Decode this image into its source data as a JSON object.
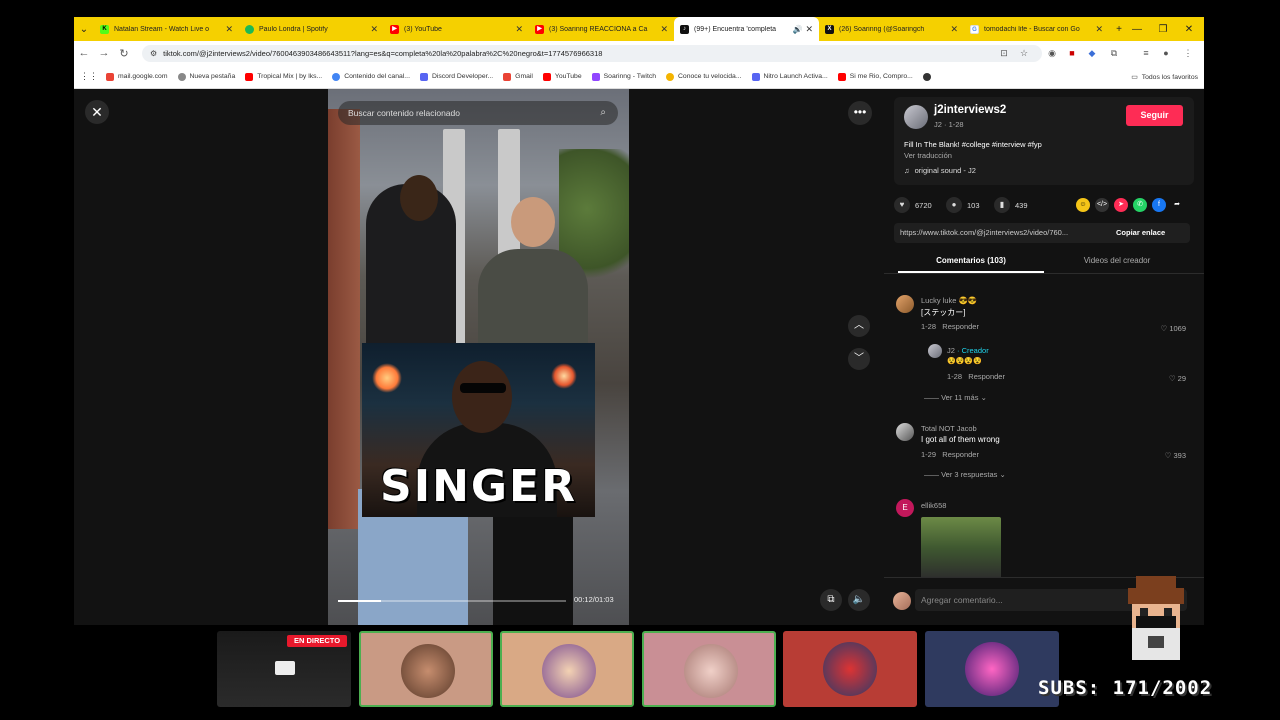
{
  "browser": {
    "tabs": [
      {
        "label": "Natalan Stream - Watch Live o",
        "favicon": "kick",
        "color": "#53fc18",
        "active": false
      },
      {
        "label": "Paulo Londra | Spotify",
        "favicon": "spotify",
        "color": "#1db954",
        "active": false
      },
      {
        "label": "(3) YouTube",
        "favicon": "youtube",
        "color": "#ff0000",
        "active": false
      },
      {
        "label": "(3) Soarinng REACCIONA a Ca",
        "favicon": "youtube",
        "color": "#ff0000",
        "active": false
      },
      {
        "label": "(99+) Encuentra 'completa",
        "favicon": "tiktok",
        "color": "#111111",
        "active": true
      },
      {
        "label": "(26) Soarinng (@Soaringch",
        "favicon": "x",
        "color": "#111111",
        "active": false
      },
      {
        "label": "tomodachi life - Buscar con Go",
        "favicon": "google",
        "color": "#4285f4",
        "active": false
      }
    ],
    "new_tab": "+",
    "url": "tiktok.com/@j2interviews2/video/7600463903486643511?lang=es&q=completa%20la%20palabra%2C%20negro&t=1774576966318",
    "bookmarks": [
      {
        "label": "mail.google.com",
        "color": "#ea4335"
      },
      {
        "label": "Nueva pestaña",
        "color": "#888888"
      },
      {
        "label": "Tropical Mix | by lks...",
        "color": "#ff0000"
      },
      {
        "label": "Contenido del canal...",
        "color": "#4285f4"
      },
      {
        "label": "Discord Developer...",
        "color": "#5865f2"
      },
      {
        "label": "Gmail",
        "color": "#ea4335"
      },
      {
        "label": "YouTube",
        "color": "#ff0000"
      },
      {
        "label": "Soarinng - Twitch",
        "color": "#9146ff"
      },
      {
        "label": "Conoce tu velocida...",
        "color": "#f4b400"
      },
      {
        "label": "Nitro Launch Activa...",
        "color": "#5865f2"
      },
      {
        "label": "Si me Rio, Compro...",
        "color": "#ff0000"
      }
    ],
    "bookmarks_right": "Todos los favoritos"
  },
  "video": {
    "search_placeholder": "Buscar contenido relacionado",
    "overlay_word": "SINGER",
    "time": "00:12/01:03",
    "progress": 0.19
  },
  "author": {
    "name": "j2interviews2",
    "sub": "J2 · 1-28",
    "follow": "Seguir",
    "description": "Fill In The Blank! #college #interview #fyp",
    "translate": "Ver traducción",
    "sound": "original sound - J2"
  },
  "stats": {
    "likes": "6720",
    "comments": "103",
    "saves": "439"
  },
  "link": {
    "url": "https://www.tiktok.com/@j2interviews2/video/760...",
    "copy": "Copiar enlace"
  },
  "tabs": {
    "comments": "Comentarios (103)",
    "creator_videos": "Videos del creador"
  },
  "comments": [
    {
      "user": "Lucky luke 😎😎",
      "text": "[ステッカー]",
      "date": "1-28",
      "reply": "Responder",
      "likes": "1069"
    },
    {
      "user": "J2",
      "creator": "· Creador",
      "text": "😵😵😵😵",
      "date": "1-28",
      "reply": "Responder",
      "likes": "29",
      "more": "Ver 11 más"
    },
    {
      "user": "Total NOT Jacob",
      "text": "I got all of them wrong",
      "date": "1-29",
      "reply": "Responder",
      "likes": "393",
      "more": "Ver 3 respuestas"
    },
    {
      "user": "ellik658",
      "avatar_letter": "E"
    }
  ],
  "comment_input": {
    "placeholder": "Agregar comentario..."
  },
  "stream": {
    "live": "EN DIRECTO",
    "subs": "SUBS: 171/2002"
  },
  "colors": {
    "tiktok_red": "#fe2c55",
    "creator": "#20d5ec",
    "tabbar": "#f5d000"
  }
}
